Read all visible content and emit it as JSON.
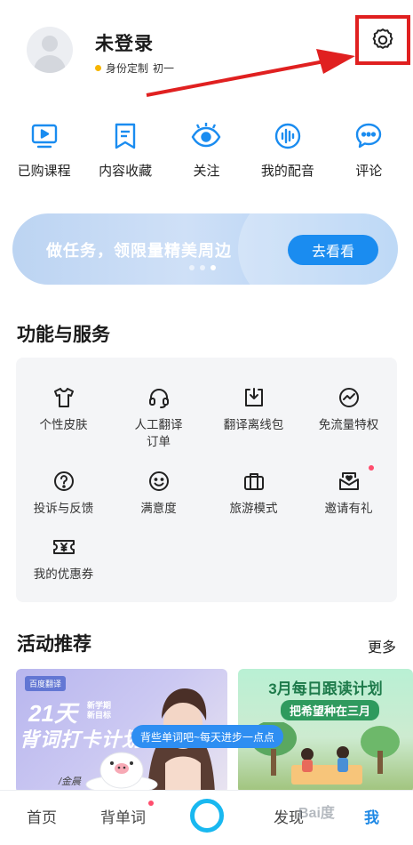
{
  "profile": {
    "name": "未登录",
    "identity": "身份定制",
    "grade": "初一"
  },
  "quick_actions": [
    {
      "label": "已购课程",
      "icon": "play-video-icon"
    },
    {
      "label": "内容收藏",
      "icon": "bookmark-icon"
    },
    {
      "label": "关注",
      "icon": "eye-icon"
    },
    {
      "label": "我的配音",
      "icon": "voice-wave-icon"
    },
    {
      "label": "评论",
      "icon": "chat-bubble-icon"
    }
  ],
  "banner": {
    "text": "做任务，领限量精美周边",
    "button": "去看看"
  },
  "services": {
    "title": "功能与服务",
    "items": [
      {
        "label": "个性皮肤",
        "icon": "tshirt-icon"
      },
      {
        "label": "人工翻译\n订单",
        "icon": "headset-icon"
      },
      {
        "label": "翻译离线包",
        "icon": "download-icon"
      },
      {
        "label": "免流量特权",
        "icon": "traffic-icon"
      },
      {
        "label": "投诉与反馈",
        "icon": "question-icon"
      },
      {
        "label": "满意度",
        "icon": "smile-icon"
      },
      {
        "label": "旅游模式",
        "icon": "suitcase-icon"
      },
      {
        "label": "邀请有礼",
        "icon": "envelope-heart-icon"
      },
      {
        "label": "我的优惠券",
        "icon": "coupon-yen-icon"
      }
    ]
  },
  "activities": {
    "title": "活动推荐",
    "more": "更多",
    "card1": {
      "logo": "百度翻译",
      "big": "21天",
      "sub1": "新学期",
      "sub2": "新目标",
      "line": "背词打卡计划",
      "author": "/金晨"
    },
    "card2": {
      "title": "3月每日跟读计划",
      "subtitle": "把希望种在三月"
    },
    "bubble": "背些单词吧~每天进步一点点"
  },
  "bottom_nav": {
    "home": "首页",
    "vocab": "背单词",
    "discover": "发现",
    "me": "我"
  },
  "watermark": "Bai度"
}
